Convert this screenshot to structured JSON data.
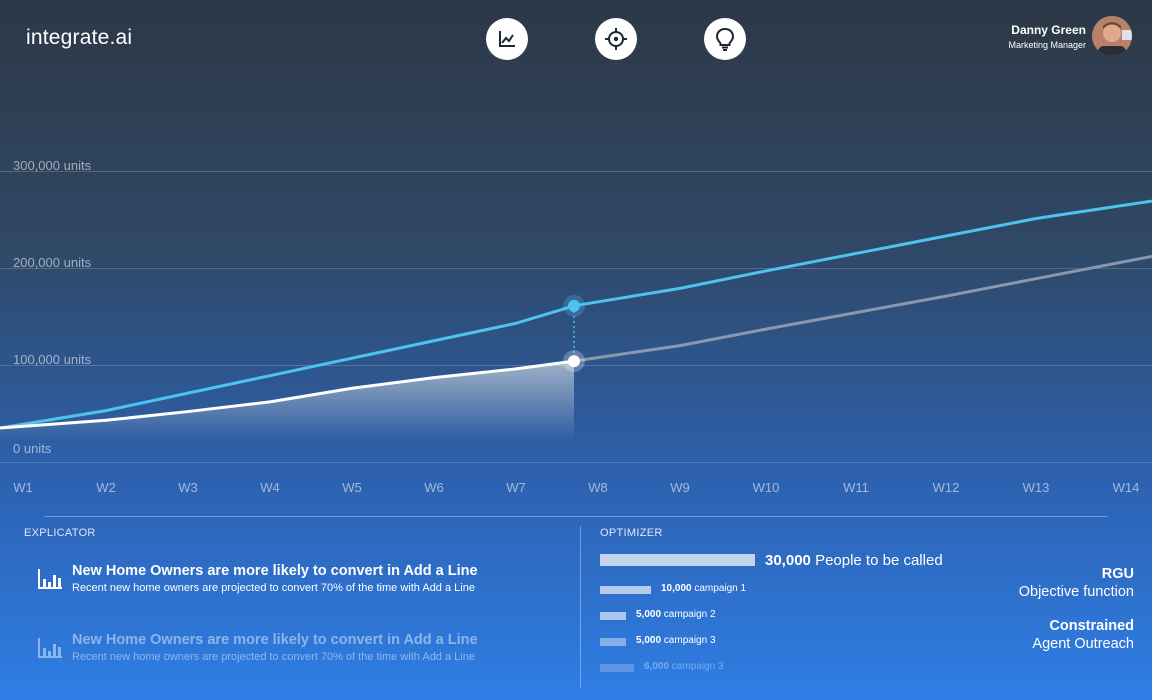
{
  "header": {
    "logo": "integrate.ai",
    "user_name": "Danny Green",
    "user_role": "Marketing Manager"
  },
  "nav_icons": [
    "chart-icon",
    "target-icon",
    "lightbulb-icon"
  ],
  "colors": {
    "forecast_line": "#4fc3f0",
    "actual_line": "#ffffff",
    "projection_line": "#8a97ad"
  },
  "chart_data": {
    "type": "line",
    "y_tick_labels": [
      "0 units",
      "100,000 units",
      "200,000 units",
      "300,000 units"
    ],
    "x": [
      "W1",
      "W2",
      "W3",
      "W4",
      "W5",
      "W6",
      "W7",
      "W8",
      "W9",
      "W10",
      "W11",
      "W12",
      "W13",
      "W14"
    ],
    "ylim": [
      0,
      350000
    ],
    "grid": true,
    "series": [
      {
        "values": [
          35000,
          53000,
          71000,
          89000,
          107000,
          125000,
          143000,
          161000,
          179000,
          197000,
          215000,
          233000,
          251000,
          269000
        ]
      },
      {
        "values": [
          35000,
          43000,
          52000,
          62000,
          76000,
          87000,
          96000,
          104000
        ]
      },
      {
        "values": [
          null,
          null,
          null,
          null,
          null,
          null,
          null,
          104000,
          120000,
          137000,
          154000,
          171000,
          189000,
          212000
        ]
      }
    ],
    "marker_week": "W8"
  },
  "explicator": {
    "title": "EXPLICATOR",
    "items": [
      {
        "headline": "New Home Owners are more likely to convert in Add a Line",
        "detail": "Recent new home owners are projected to convert 70% of the time with Add a Line"
      },
      {
        "headline": "New Home Owners are more likely to convert in Add a Line",
        "detail": "Recent new home owners are projected to convert 70% of the time with Add a Line"
      }
    ]
  },
  "optimizer": {
    "title": "OPTIMIZER",
    "total_value": "30,000",
    "total_label": "People to be called",
    "total_fraction": 1.0,
    "campaigns": [
      {
        "value": "10,000",
        "label": "campaign 1",
        "fraction": 0.33
      },
      {
        "value": "5,000",
        "label": "campaign 2",
        "fraction": 0.17
      },
      {
        "value": "5,000",
        "label": "campaign 3",
        "fraction": 0.17
      },
      {
        "value": "6,000",
        "label": "campaign 3",
        "fraction": 0.22
      }
    ],
    "objective_title": "RGU",
    "objective_sub": "Objective function",
    "constraint_title": "Constrained",
    "constraint_sub": "Agent Outreach"
  }
}
